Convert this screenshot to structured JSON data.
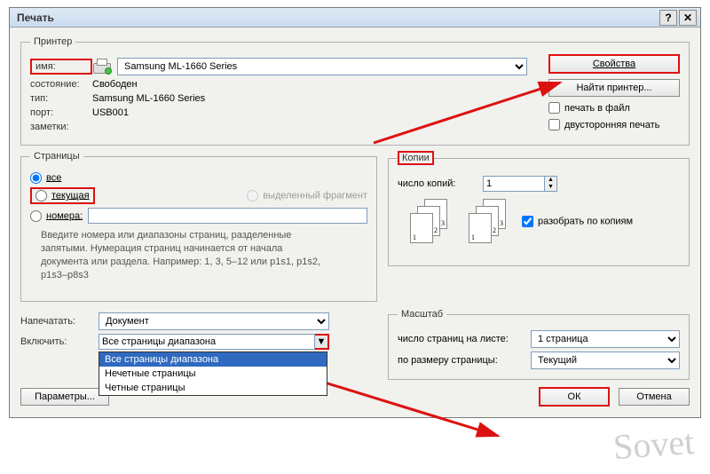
{
  "title": "Печать",
  "printer": {
    "legend": "Принтер",
    "name_lbl": "имя:",
    "name_value": "Samsung ML-1660 Series",
    "state_lbl": "состояние:",
    "state_value": "Свободен",
    "type_lbl": "тип:",
    "type_value": "Samsung ML-1660 Series",
    "port_lbl": "порт:",
    "port_value": "USB001",
    "notes_lbl": "заметки:",
    "btn_props": "Свойства",
    "btn_find": "Найти принтер...",
    "chk_file": "печать в файл",
    "chk_duplex": "двусторонняя печать"
  },
  "pages": {
    "legend": "Страницы",
    "radio_all": "все",
    "radio_current": "текущая",
    "radio_numbers": "номера:",
    "radio_selection": "выделенный фрагмент",
    "hint": "Введите номера или диапазоны страниц, разделенные запятыми. Нумерация страниц начинается от начала документа или раздела. Например: 1, 3, 5–12 или p1s1, p1s2, p1s3–p8s3"
  },
  "copies": {
    "legend": "Копии",
    "count_lbl": "число копий:",
    "count_value": "1",
    "collate": "разобрать по копиям"
  },
  "print_what_lbl": "Напечатать:",
  "print_what_value": "Документ",
  "include_lbl": "Включить:",
  "include_value": "Все страницы диапазона",
  "include_options": [
    "Все страницы диапазона",
    "Нечетные страницы",
    "Четные страницы"
  ],
  "scale": {
    "legend": "Масштаб",
    "pages_per_sheet_lbl": "число страниц на листе:",
    "pages_per_sheet_value": "1 страница",
    "fit_lbl": "по размеру страницы:",
    "fit_value": "Текущий"
  },
  "btn_params": "Параметры...",
  "btn_ok": "ОК",
  "btn_cancel": "Отмена",
  "watermark": "Sovet"
}
